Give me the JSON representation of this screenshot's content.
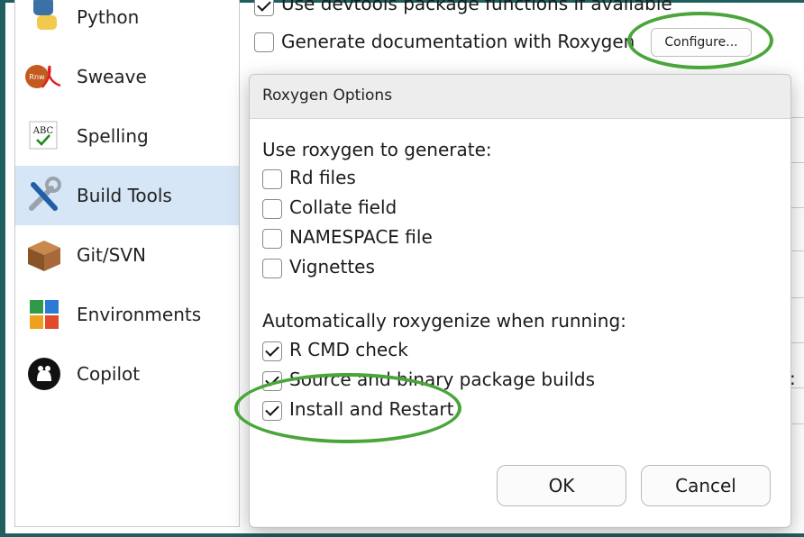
{
  "sidebar": {
    "items": [
      {
        "label": "Python",
        "icon": "python-icon",
        "selected": false
      },
      {
        "label": "Sweave",
        "icon": "sweave-icon",
        "selected": false
      },
      {
        "label": "Spelling",
        "icon": "spelling-icon",
        "selected": false
      },
      {
        "label": "Build Tools",
        "icon": "build-tools-icon",
        "selected": true
      },
      {
        "label": "Git/SVN",
        "icon": "git-svn-icon",
        "selected": false
      },
      {
        "label": "Environments",
        "icon": "environments-icon",
        "selected": false
      },
      {
        "label": "Copilot",
        "icon": "copilot-icon",
        "selected": false
      }
    ],
    "sweave_icon_text": "Rnw",
    "spelling_icon_text": "ABC"
  },
  "main": {
    "devtools_label": "Use devtools package functions if available",
    "devtools_checked": true,
    "roxygen_label": "Generate documentation with Roxygen",
    "roxygen_checked": false,
    "configure_label": "Configure..."
  },
  "dialog": {
    "title": "Roxygen Options",
    "generate_heading": "Use roxygen to generate:",
    "generate_options": [
      {
        "label": "Rd files",
        "checked": false
      },
      {
        "label": "Collate field",
        "checked": false
      },
      {
        "label": "NAMESPACE file",
        "checked": false
      },
      {
        "label": "Vignettes",
        "checked": false
      }
    ],
    "auto_heading": "Automatically roxygenize when running:",
    "auto_options": [
      {
        "label": "R CMD check",
        "checked": true
      },
      {
        "label": "Source and binary package builds",
        "checked": true
      },
      {
        "label": "Install and Restart",
        "checked": true
      }
    ],
    "ok_label": "OK",
    "cancel_label": "Cancel"
  },
  "colors": {
    "highlight_ellipse": "#4aa53a",
    "frame": "#1f5f5f",
    "selected_bg": "#d7e6f6"
  }
}
